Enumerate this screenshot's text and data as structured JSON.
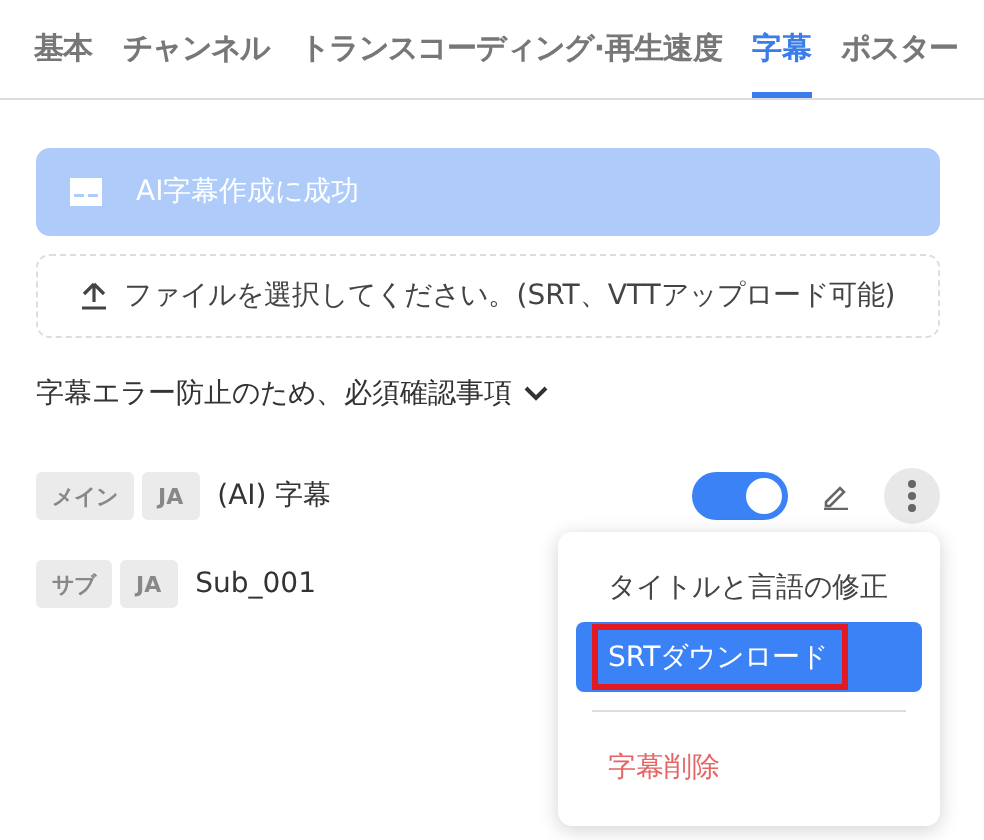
{
  "tabs": [
    {
      "label": "基本",
      "selected": false
    },
    {
      "label": "チャンネル",
      "selected": false
    },
    {
      "label": "トランスコーディング·再生速度",
      "selected": false
    },
    {
      "label": "字幕",
      "selected": true
    },
    {
      "label": "ポスター",
      "selected": false
    }
  ],
  "banner": {
    "text": "AI字幕作成に成功"
  },
  "upload": {
    "text": "ファイルを選択してください。(SRT、VTTアップロード可能)"
  },
  "notice": {
    "text": "字幕エラー防止のため、必須確認事項",
    "expanded": false
  },
  "subtitles": [
    {
      "role": "メイン",
      "lang": "JA",
      "name": "(AI) 字幕",
      "on": true
    },
    {
      "role": "サブ",
      "lang": "JA",
      "name": "Sub_001"
    }
  ],
  "menu": {
    "items": [
      {
        "kind": "item",
        "label": "タイトルと言語の修正",
        "selected": false,
        "highlighted": false
      },
      {
        "kind": "item",
        "label": "SRTダウンロード",
        "selected": true,
        "highlighted": true
      },
      {
        "kind": "divider"
      },
      {
        "kind": "danger",
        "label": "字幕削除",
        "selected": false,
        "highlighted": false
      }
    ]
  }
}
